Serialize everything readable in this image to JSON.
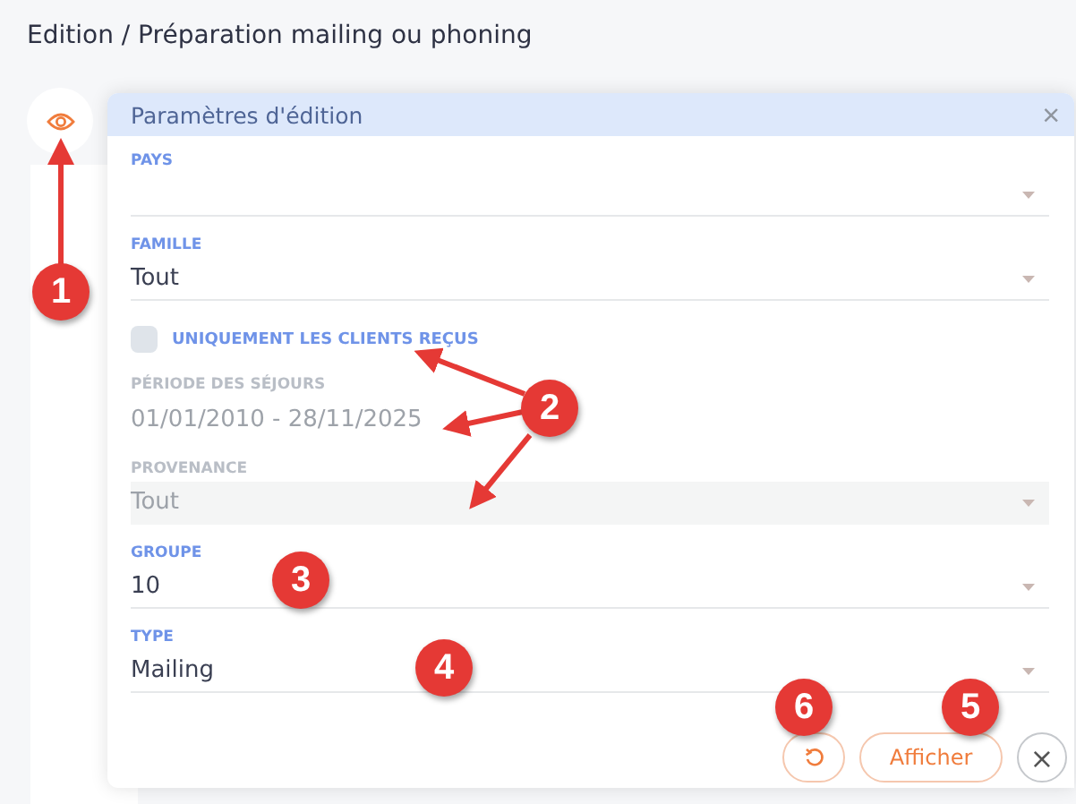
{
  "page": {
    "title": "Edition / Préparation mailing ou phoning"
  },
  "dialog": {
    "title": "Paramètres d'édition",
    "close": "×",
    "fields": [
      {
        "kind": "select",
        "label": "PAYS",
        "disabled": false
      },
      {
        "kind": "select",
        "label": "FAMILLE",
        "value": "Tout",
        "disabled": false
      },
      {
        "kind": "checkbox",
        "label": "UNIQUEMENT LES CLIENTS REÇUS",
        "checked": false
      },
      {
        "kind": "text",
        "label": "PÉRIODE DES SÉJOURS",
        "value": "01/01/2010 - 28/11/2025",
        "disabled": true
      },
      {
        "kind": "select",
        "label": "PROVENANCE",
        "value": "Tout",
        "disabled": true
      },
      {
        "kind": "select",
        "label": "GROUPE",
        "value": "10",
        "disabled": false
      },
      {
        "kind": "select",
        "label": "TYPE",
        "value": "Mailing",
        "disabled": false
      }
    ],
    "buttons": [
      {
        "kind": "reset"
      },
      {
        "kind": "primary",
        "label": "Afficher"
      },
      {
        "kind": "close",
        "label": "×"
      }
    ]
  },
  "annotations": [
    {
      "label": "1"
    },
    {
      "label": "2"
    },
    {
      "label": "3"
    },
    {
      "label": "4"
    },
    {
      "label": "6"
    },
    {
      "label": "5"
    }
  ]
}
